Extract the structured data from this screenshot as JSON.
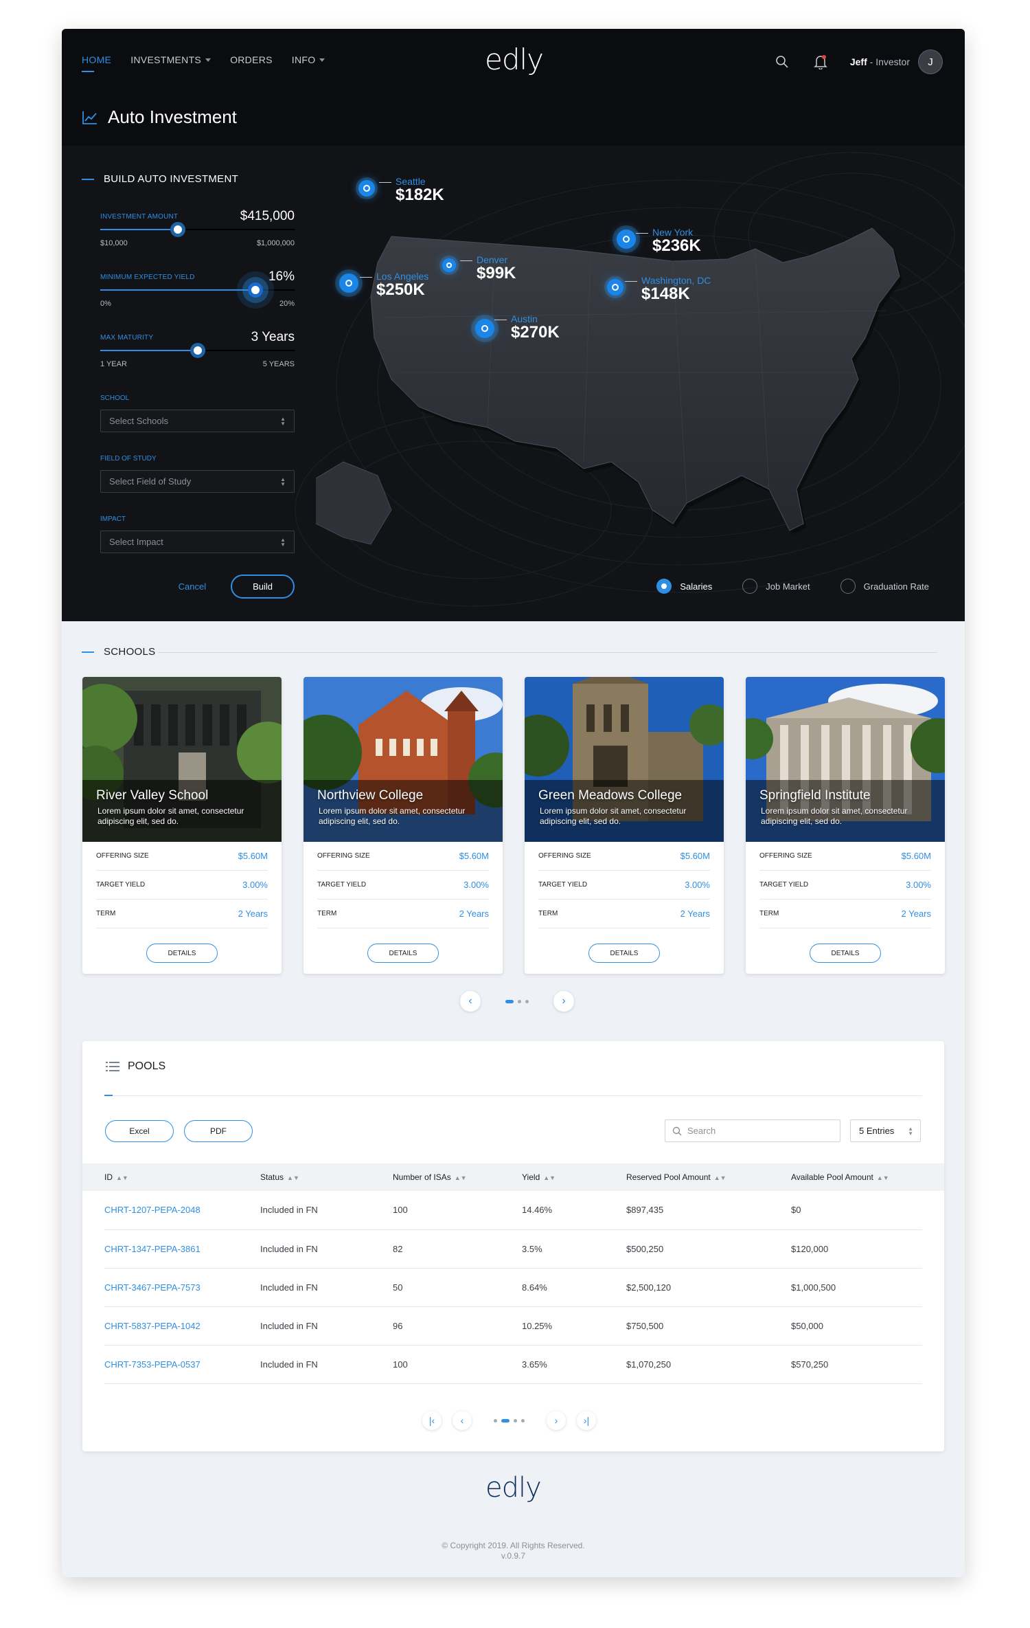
{
  "nav": {
    "items": [
      {
        "label": "HOME",
        "active": true,
        "dropdown": false
      },
      {
        "label": "INVESTMENTS",
        "active": false,
        "dropdown": true
      },
      {
        "label": "ORDERS",
        "active": false,
        "dropdown": false
      },
      {
        "label": "INFO",
        "active": false,
        "dropdown": true
      }
    ],
    "logo": "edly",
    "user_name": "Jeff",
    "user_role": "- Investor",
    "avatar_initial": "J"
  },
  "page_title": "Auto Investment",
  "build": {
    "heading": "BUILD AUTO INVESTMENT",
    "investment_amount": {
      "label": "INVESTMENT AMOUNT",
      "value": "$415,000",
      "min": "$10,000",
      "max": "$1,000,000",
      "fraction": 0.4
    },
    "min_yield": {
      "label": "MINIMUM EXPECTED YIELD",
      "value": "16%",
      "min": "0%",
      "max": "20%",
      "fraction": 0.8
    },
    "max_maturity": {
      "label": "MAX MATURITY",
      "value": "3 Years",
      "min": "1 YEAR",
      "max": "5 YEARS",
      "fraction": 0.5
    },
    "school": {
      "label": "SCHOOL",
      "placeholder": "Select Schools"
    },
    "field": {
      "label": "FIELD OF STUDY",
      "placeholder": "Select Field of Study"
    },
    "impact": {
      "label": "IMPACT",
      "placeholder": "Select Impact"
    },
    "cancel": "Cancel",
    "build": "Build"
  },
  "map": {
    "pins": [
      {
        "city": "Seattle",
        "amount": "$182K"
      },
      {
        "city": "Denver",
        "amount": "$99K"
      },
      {
        "city": "Los Angeles",
        "amount": "$250K"
      },
      {
        "city": "New York",
        "amount": "$236K"
      },
      {
        "city": "Washington, DC",
        "amount": "$148K"
      },
      {
        "city": "Austin",
        "amount": "$270K"
      }
    ],
    "layers": [
      {
        "label": "Salaries",
        "selected": true
      },
      {
        "label": "Job Market",
        "selected": false
      },
      {
        "label": "Graduation Rate",
        "selected": false
      }
    ]
  },
  "schools": {
    "heading": "SCHOOLS",
    "cards": [
      {
        "name": "River Valley School",
        "desc": "Lorem ipsum dolor sit amet, consectetur adipiscing elit, sed do.",
        "offering_size": "$5.60M",
        "target_yield": "3.00%",
        "term": "2 Years"
      },
      {
        "name": "Northview College",
        "desc": "Lorem ipsum dolor sit amet, consectetur adipiscing elit, sed do.",
        "offering_size": "$5.60M",
        "target_yield": "3.00%",
        "term": "2 Years"
      },
      {
        "name": "Green Meadows College",
        "desc": "Lorem ipsum dolor sit amet, consectetur adipiscing elit, sed do.",
        "offering_size": "$5.60M",
        "target_yield": "3.00%",
        "term": "2 Years"
      },
      {
        "name": "Springfield Institute",
        "desc": "Lorem ipsum dolor sit amet, consectetur adipiscing elit, sed do.",
        "offering_size": "$5.60M",
        "target_yield": "3.00%",
        "term": "2 Years"
      }
    ],
    "labels": {
      "offering_size": "OFFERING SIZE",
      "target_yield": "TARGET YIELD",
      "term": "TERM",
      "details": "DETAILS"
    }
  },
  "pools": {
    "heading": "POOLS",
    "excel": "Excel",
    "pdf": "PDF",
    "search_placeholder": "Search",
    "entries": "5 Entries",
    "columns": [
      "ID",
      "Status",
      "Number of ISAs",
      "Yield",
      "Reserved Pool Amount",
      "Available Pool Amount"
    ],
    "rows": [
      [
        "CHRT-1207-PEPA-2048",
        "Included in FN",
        "100",
        "14.46%",
        "$897,435",
        "$0"
      ],
      [
        "CHRT-1347-PEPA-3861",
        "Included in FN",
        "82",
        "3.5%",
        "$500,250",
        "$120,000"
      ],
      [
        "CHRT-3467-PEPA-7573",
        "Included in FN",
        "50",
        "8.64%",
        "$2,500,120",
        "$1,000,500"
      ],
      [
        "CHRT-5837-PEPA-1042",
        "Included in FN",
        "96",
        "10.25%",
        "$750,500",
        "$50,000"
      ],
      [
        "CHRT-7353-PEPA-0537",
        "Included in FN",
        "100",
        "3.65%",
        "$1,070,250",
        "$570,250"
      ]
    ]
  },
  "footer": {
    "logo": "edly",
    "copyright": "© Copyright 2019. All Rights Reserved.",
    "version": "v.0.9.7"
  },
  "colors": {
    "accent": "#2f8fe4",
    "dark_bg": "#111317",
    "light_bg": "#eef1f5"
  }
}
